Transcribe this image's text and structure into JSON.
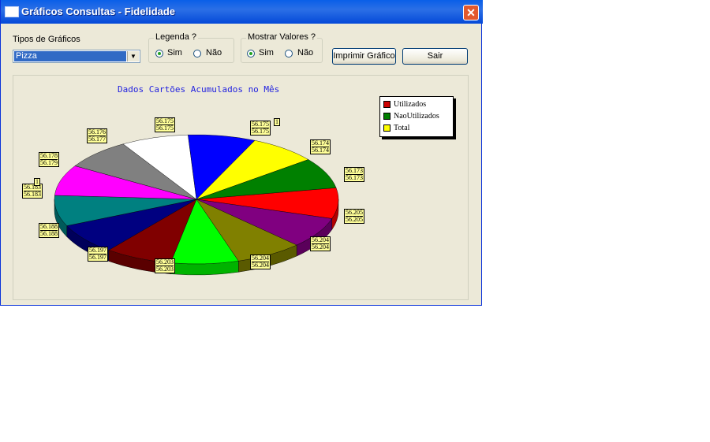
{
  "window": {
    "title": "Gráficos Consultas - Fidelidade",
    "close_symbol": "✕"
  },
  "controls": {
    "tipos_label": "Tipos de Gráficos",
    "tipos_value": "Pizza",
    "legenda": {
      "label": "Legenda ?",
      "options": [
        "Sim",
        "Não"
      ],
      "selected": "Sim"
    },
    "mostrar_valores": {
      "label": "Mostrar Valores ?",
      "options": [
        "Sim",
        "Não"
      ],
      "selected": "Sim"
    },
    "imprimir_label": "Imprimir Gráfico",
    "sair_label": "Sair"
  },
  "chart_data": {
    "type": "pie",
    "title": "Dados Cartões Acumulados no Mês",
    "legend": {
      "placement": "top-right",
      "entries": [
        {
          "label": "Utilizados",
          "color": "#cc0000"
        },
        {
          "label": "NaoUtilizados",
          "color": "#007f00"
        },
        {
          "label": "Total",
          "color": "#ffff00"
        }
      ]
    },
    "slices": [
      {
        "color": "#ff0000",
        "labels": [
          "56.173",
          "56.173"
        ]
      },
      {
        "color": "#800080",
        "labels": [
          "56.205",
          "56.205"
        ]
      },
      {
        "color": "#808000",
        "labels": [
          "56.204",
          "56.204"
        ]
      },
      {
        "color": "#00ff00",
        "labels": [
          "56.204",
          "56.204"
        ]
      },
      {
        "color": "#800000",
        "labels": [
          "56.203",
          "56.203"
        ]
      },
      {
        "color": "#000080",
        "labels": [
          "56.197",
          "56.197"
        ]
      },
      {
        "color": "#008080",
        "labels": [
          "56.188",
          "56.188"
        ]
      },
      {
        "color": "#ff00ff",
        "labels": [
          "56.183",
          "56.183"
        ]
      },
      {
        "color": "#808080",
        "labels": [
          "56.178",
          "56.179"
        ]
      },
      {
        "color": "#ffffff",
        "labels": [
          "56.176",
          "56.177"
        ]
      },
      {
        "color": "#0000ff",
        "labels": [
          "56.175",
          "56.175"
        ]
      },
      {
        "color": "#ffff00",
        "labels": [
          "56.175",
          "56.175"
        ]
      },
      {
        "color": "#008000",
        "labels": [
          "56.174",
          "56.174"
        ]
      }
    ],
    "extra_labels": [
      "1",
      "1"
    ]
  }
}
